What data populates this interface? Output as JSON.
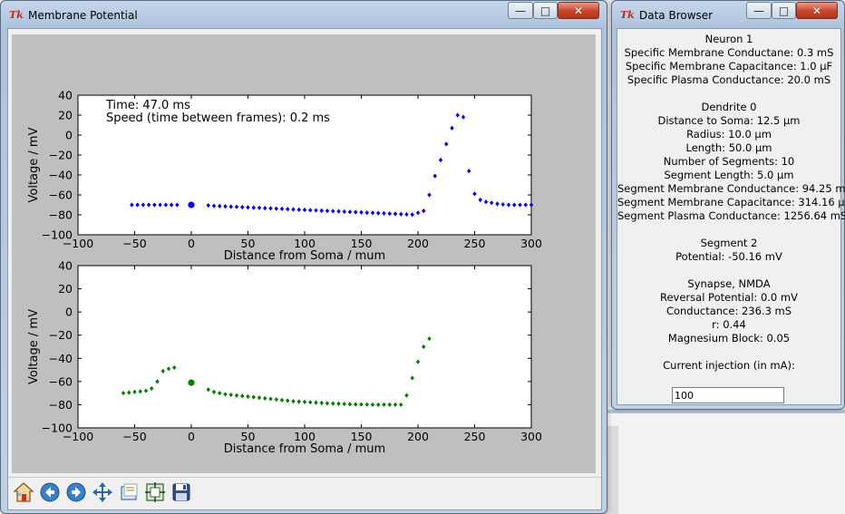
{
  "plot_window": {
    "title": "Membrane Potential",
    "buttons": {
      "minimize": "—",
      "maximize": "□",
      "close": "✕"
    },
    "overlay": {
      "time_text": "Time: 47.0 ms",
      "speed_text": "Speed (time between frames): 0.2 ms"
    },
    "toolbar": [
      "home-icon",
      "back-arrow-icon",
      "forward-arrow-icon",
      "pan-move-icon",
      "zoom-rect-icon",
      "subplots-config-icon",
      "save-floppy-icon"
    ]
  },
  "chart_data": [
    {
      "type": "scatter",
      "color": "#0000ff",
      "xlabel": "Distance from Soma / mum",
      "ylabel": "Voltage / mV",
      "xlim": [
        -100,
        300
      ],
      "ylim": [
        -100,
        40
      ],
      "xticks": [
        "−100",
        "−50",
        "0",
        "50",
        "100",
        "150",
        "200",
        "250",
        "300"
      ],
      "yticks": [
        "40",
        "20",
        "0",
        "−20",
        "−40",
        "−60",
        "−80",
        "−100"
      ],
      "soma": {
        "x": 0,
        "y": -70
      },
      "series": [
        {
          "x": [
            -52.5,
            -47.5,
            -42.5,
            -37.5,
            -32.5,
            -27.5,
            -22.5,
            -17.5,
            -12.5,
            15,
            20,
            25,
            30,
            35,
            40,
            45,
            50,
            55,
            60,
            65,
            70,
            75,
            80,
            85,
            90,
            95,
            100,
            105,
            110,
            115,
            120,
            125,
            130,
            135,
            140,
            145,
            150,
            155,
            160,
            165,
            170,
            175,
            180,
            185,
            190,
            195,
            200,
            205,
            210,
            215,
            220,
            225,
            230,
            235,
            240,
            245,
            250,
            255,
            260,
            265,
            270,
            275,
            280,
            285,
            290,
            295,
            300
          ],
          "y": [
            -70,
            -70,
            -70,
            -70,
            -70,
            -70,
            -70,
            -70,
            -70,
            -70.5,
            -71,
            -71.2,
            -71.5,
            -71.8,
            -72,
            -72.3,
            -72.5,
            -72.8,
            -73,
            -73.3,
            -73.5,
            -73.8,
            -74,
            -74.3,
            -74.5,
            -74.8,
            -75,
            -75.3,
            -75.5,
            -75.8,
            -76,
            -76.3,
            -76.5,
            -76.8,
            -77,
            -77.3,
            -77.5,
            -77.8,
            -78,
            -78.3,
            -78.5,
            -78.8,
            -79,
            -79.3,
            -79.5,
            -79.8,
            -78,
            -76,
            -60,
            -41,
            -25,
            -9,
            7,
            20,
            18,
            -36,
            -59,
            -65,
            -67,
            -68,
            -69,
            -69.5,
            -70,
            -70,
            -70,
            -70,
            -70
          ]
        }
      ]
    },
    {
      "type": "scatter",
      "color": "#007f00",
      "xlabel": "Distance from Soma / mum",
      "ylabel": "Voltage / mV",
      "xlim": [
        -100,
        300
      ],
      "ylim": [
        -100,
        40
      ],
      "xticks": [
        "−100",
        "−50",
        "0",
        "50",
        "100",
        "150",
        "200",
        "250",
        "300"
      ],
      "yticks": [
        "40",
        "20",
        "0",
        "−20",
        "−40",
        "−60",
        "−80",
        "−100"
      ],
      "soma": {
        "x": 0,
        "y": -61
      },
      "series": [
        {
          "x": [
            -60,
            -55,
            -50,
            -45,
            -40,
            -35,
            -30,
            -25,
            -20,
            -15,
            15,
            20,
            25,
            30,
            35,
            40,
            45,
            50,
            55,
            60,
            65,
            70,
            75,
            80,
            85,
            90,
            95,
            100,
            105,
            110,
            115,
            120,
            125,
            130,
            135,
            140,
            145,
            150,
            155,
            160,
            165,
            170,
            175,
            180,
            185,
            190,
            195,
            200,
            205,
            210
          ],
          "y": [
            -70,
            -69.5,
            -69,
            -68.5,
            -68,
            -66,
            -60,
            -51,
            -49,
            -48,
            -67,
            -69,
            -70,
            -71,
            -71.5,
            -72,
            -72.5,
            -73,
            -73.5,
            -74,
            -74.5,
            -75,
            -75.5,
            -76,
            -76.5,
            -77,
            -77.3,
            -77.6,
            -77.9,
            -78.2,
            -78.5,
            -78.8,
            -79,
            -79.2,
            -79.4,
            -79.6,
            -79.7,
            -79.8,
            -79.9,
            -80,
            -80,
            -80,
            -80,
            -80,
            -80,
            -72,
            -57,
            -43,
            -30,
            -23
          ]
        }
      ]
    }
  ],
  "browser_window": {
    "title": "Data Browser",
    "buttons": {
      "minimize": "—",
      "maximize": "□",
      "close": "✕"
    },
    "lines": [
      "Neuron 1",
      "Specific Membrane Conductane: 0.3 mS",
      "Specific Membrane Capacitance: 1.0 µF",
      "Specific Plasma Conductance: 20.0 mS",
      "",
      "Dendrite 0",
      "Distance to Soma: 12.5 µm",
      "Radius: 10.0 µm",
      "Length: 50.0 µm",
      "Number of Segments: 10",
      "Segment Length: 5.0 µm",
      "Segment Membrane Conductance: 94.25 mS",
      "Segment Membrane Capacitance: 314.16 µF",
      "Segment Plasma Conductance: 1256.64 mS",
      "",
      "Segment 2",
      "Potential: -50.16 mV",
      "",
      "Synapse, NMDA",
      "Reversal Potential: 0.0 mV",
      "Conductance: 236.3 mS",
      "r: 0.44",
      "Magnesium Block: 0.05",
      "",
      "Current injection (in mA):"
    ],
    "injection_value": "100"
  }
}
